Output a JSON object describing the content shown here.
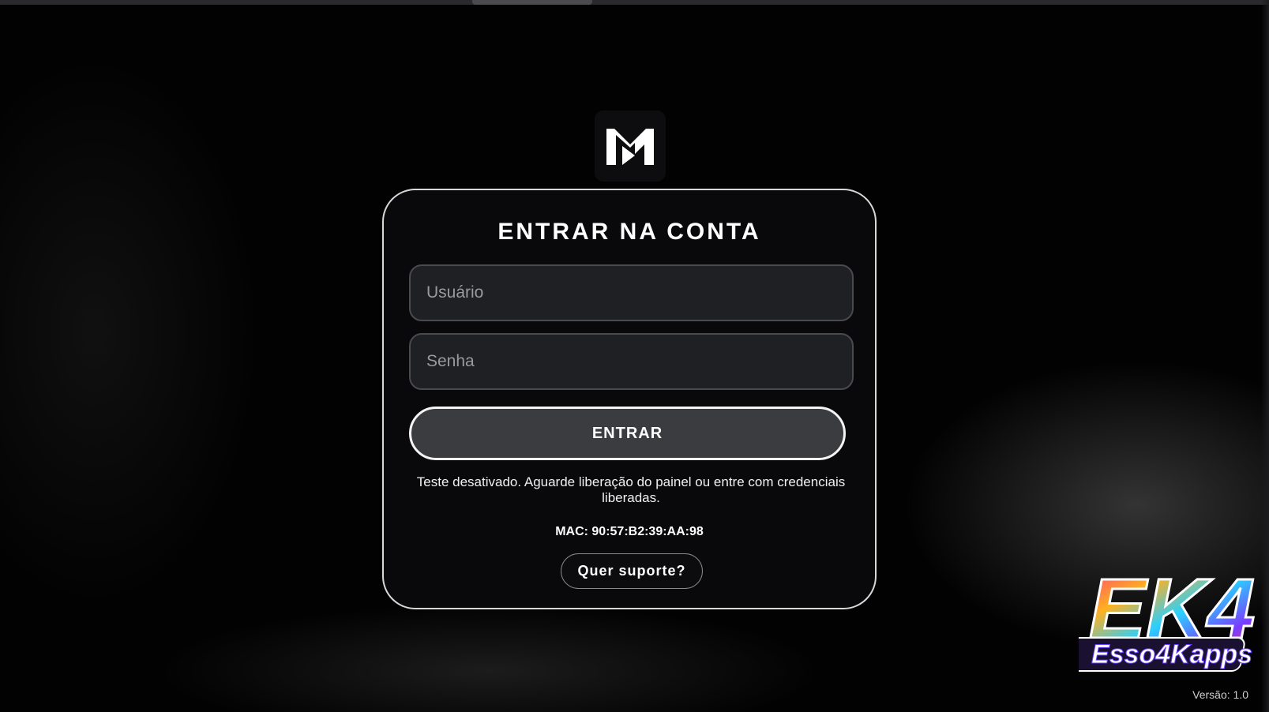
{
  "login": {
    "title": "ENTRAR NA CONTA",
    "username_placeholder": "Usuário",
    "password_placeholder": "Senha",
    "submit_label": "ENTRAR",
    "notice": "Teste desativado. Aguarde liberação do painel ou entre com credenciais liberadas.",
    "mac": "MAC: 90:57:B2:39:AA:98",
    "support_label": "Quer suporte?"
  },
  "branding": {
    "app_logo_icon": "m-play-logo-icon",
    "brand_top": "EK4",
    "brand_bottom": "Esso4Kapps"
  },
  "footer": {
    "version": "Versão: 1.0"
  },
  "colors": {
    "background": "#020202",
    "card_border": "#d8d8d8",
    "field_bg": "#1f2023",
    "button_bg": "#3b3c40"
  }
}
